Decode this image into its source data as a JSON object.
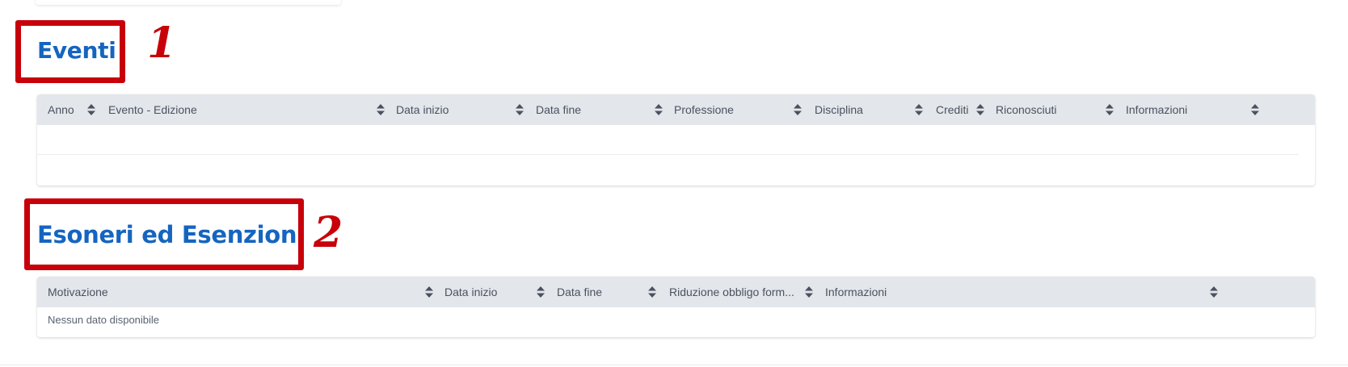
{
  "sections": {
    "eventi": {
      "title": "Eventi",
      "annotation_number": "1",
      "columns": [
        "Anno",
        "Evento - Edizione",
        "Data inizio",
        "Data fine",
        "Professione",
        "Disciplina",
        "Crediti",
        "Riconosciuti",
        "Informazioni"
      ]
    },
    "esoneri": {
      "title": "Esoneri ed Esenzioni",
      "annotation_number": "2",
      "columns": [
        "Motivazione",
        "Data inizio",
        "Data fine",
        "Riduzione obbligo form...",
        "Informazioni"
      ],
      "empty_message": "Nessun dato disponibile"
    }
  },
  "colors": {
    "title_blue": "#1565c0",
    "annotation_red": "#c8000a",
    "header_bg": "#e3e6ea"
  },
  "icons": {
    "sort": "sort-icon"
  }
}
